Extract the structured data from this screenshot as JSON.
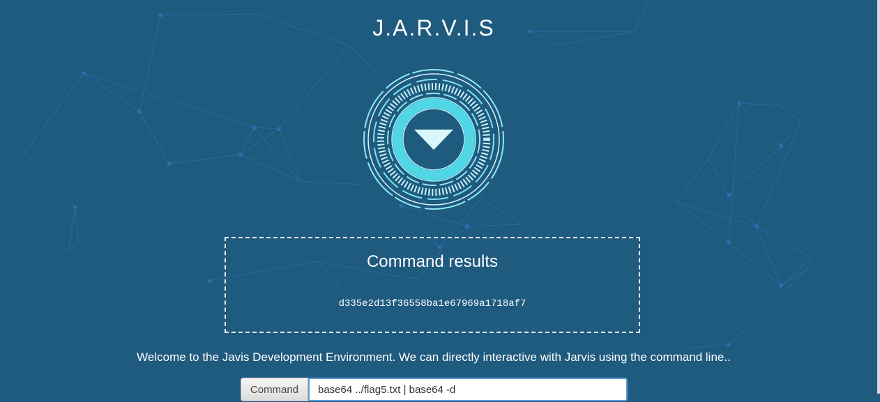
{
  "app": {
    "title": "J.A.R.V.I.S"
  },
  "results": {
    "heading": "Command results",
    "output": "d335e2d13f36558ba1e67969a1718af7"
  },
  "welcome": "Welcome to the Javis Development Environment. We can directly interactive with Jarvis using the command line..",
  "command": {
    "label": "Command",
    "value": "base64 ../flag5.txt | base64 -d"
  },
  "colors": {
    "background": "#1f5a7f",
    "reactor_glow": "#6fe6f0",
    "network_lines": "#2f78b8",
    "input_focus": "#5c9bd6"
  },
  "icons": {
    "reactor": "arc-reactor-icon",
    "down": "triangle-down-icon"
  }
}
